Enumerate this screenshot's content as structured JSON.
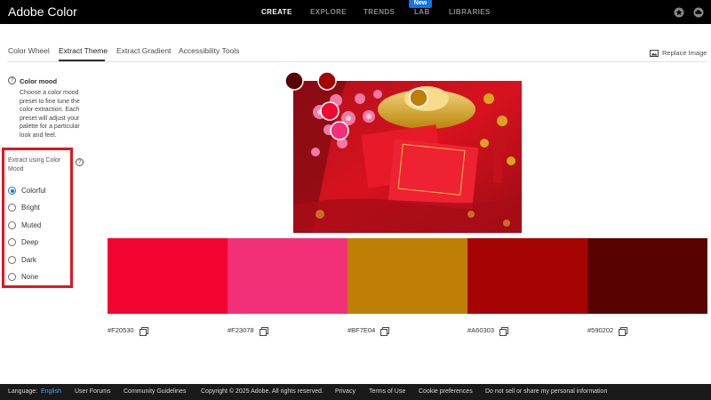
{
  "app": {
    "title": "Adobe Color"
  },
  "nav": {
    "create": "CREATE",
    "explore": "EXPLORE",
    "trends": "TRENDS",
    "lab": "LAB",
    "lab_badge": "New",
    "libraries": "LIBRARIES"
  },
  "tabs": {
    "color_wheel": "Color Wheel",
    "extract_theme": "Extract Theme",
    "extract_gradient": "Extract Gradient",
    "accessibility_tools": "Accessibility Tools"
  },
  "replace_image": "Replace Image",
  "mood": {
    "title": "Color mood",
    "description": "Choose a color mood preset to fine tune the color extraction. Each preset will adjust your palette for a particular look and feel.",
    "extract_label": "Extract using Color Mood",
    "options": [
      "Colorful",
      "Bright",
      "Muted",
      "Deep",
      "Dark",
      "None"
    ],
    "selected": "Colorful"
  },
  "palette": [
    {
      "hex": "#F20530",
      "color": "#F20530"
    },
    {
      "hex": "#F23078",
      "color": "#F23078"
    },
    {
      "hex": "#BF7E04",
      "color": "#BF7E04"
    },
    {
      "hex": "#A60303",
      "color": "#A60303"
    },
    {
      "hex": "#590202",
      "color": "#590202"
    }
  ],
  "footer": {
    "language_label": "Language:",
    "language_value": "English",
    "user_forums": "User Forums",
    "community_guidelines": "Community Guidelines",
    "copyright": "Copyright © 2025 Adobe. All rights reserved.",
    "privacy": "Privacy",
    "terms": "Terms of Use",
    "cookie": "Cookie preferences",
    "do_not_sell": "Do not sell or share my personal information"
  }
}
